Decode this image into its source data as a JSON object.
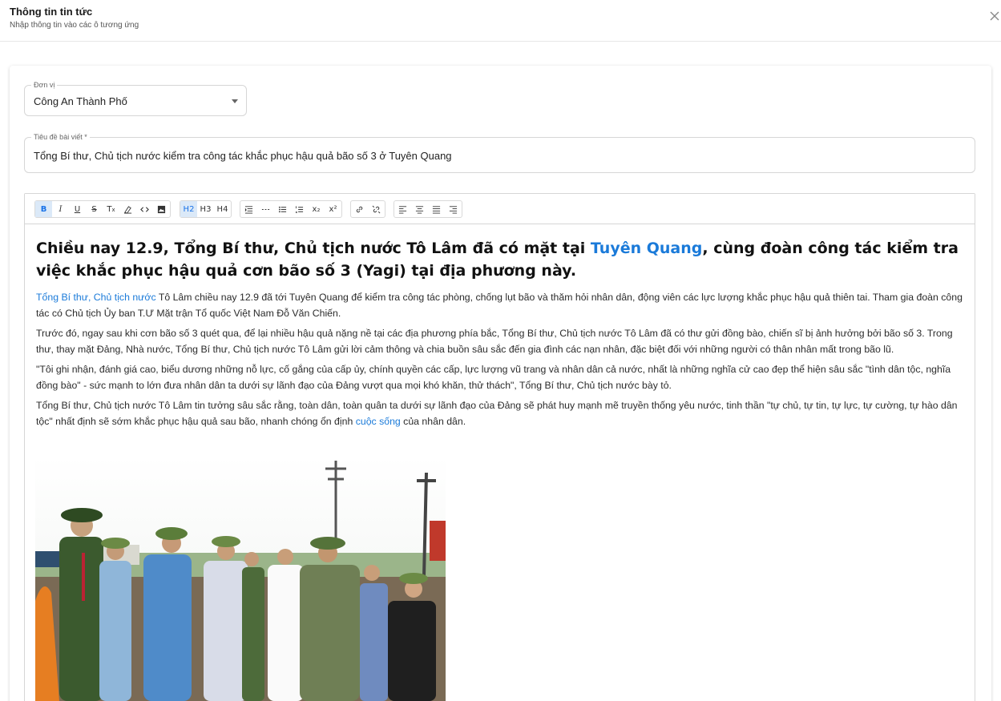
{
  "dialog": {
    "title": "Thông tin tin tức",
    "subtitle": "Nhập thông tin vào các ô tương ứng"
  },
  "form": {
    "unit": {
      "label": "Đơn vị",
      "value": "Công An Thành Phố"
    },
    "headline": {
      "label": "Tiêu đề bài viết *",
      "value": "Tổng Bí thư, Chủ tịch nước kiểm tra công tác khắc phục hậu quả bão số 3 ở Tuyên Quang"
    }
  },
  "toolbar": {
    "heading_buttons": [
      "H2",
      "H3",
      "H4"
    ],
    "subscript": "x₂",
    "superscript": "x²"
  },
  "article": {
    "heading_pre": "Chiều nay 12.9, Tổng Bí thư, Chủ tịch nước Tô Lâm đã có mặt tại ",
    "heading_link": "Tuyên Quang",
    "heading_post": ", cùng đoàn công tác kiểm tra việc khắc phục hậu quả cơn bão số 3 (Yagi) tại địa phương này.",
    "p1_link": "Tổng Bí thư, Chủ tịch nước",
    "p1_text": " Tô Lâm chiều nay 12.9 đã tới Tuyên Quang để kiểm tra công tác phòng, chống lụt bão và thăm hỏi nhân dân, động viên các lực lượng khắc phục hậu quả thiên tai. Tham gia đoàn công tác có Chủ tịch Ủy ban T.Ư Mặt trận Tổ quốc Việt Nam Đỗ Văn Chiến.",
    "p2": "Trước đó, ngay sau khi cơn bão số 3 quét qua, để lại nhiều hậu quả nặng nề tại các địa phương phía bắc, Tổng Bí thư, Chủ tịch nước Tô Lâm đã có thư gửi đồng bào, chiến sĩ bị ảnh hưởng bởi bão số 3. Trong thư, thay mặt Đảng, Nhà nước, Tổng Bí thư, Chủ tịch nước Tô Lâm gửi lời cảm thông và chia buồn sâu sắc đến gia đình các nạn nhân, đặc biệt đối với những người có thân nhân mất trong bão lũ.",
    "p3": "\"Tôi ghi nhận, đánh giá cao, biểu dương những nỗ lực, cố gắng của cấp ủy, chính quyền các cấp, lực lượng vũ trang và nhân dân cả nước, nhất là những nghĩa cử cao đẹp thể hiện sâu sắc \"tình dân tộc, nghĩa đồng bào\" - sức mạnh to lớn đưa nhân dân ta dưới sự lãnh đạo của Đảng vượt qua mọi khó khăn, thử thách\", Tổng Bí thư, Chủ tịch nước bày tỏ.",
    "p4_text": "Tổng Bí thư, Chủ tịch nước Tô Lâm tin tưởng sâu sắc rằng, toàn dân, toàn quân ta dưới sự lãnh đạo của Đảng sẽ phát huy mạnh mẽ truyền thống yêu nước, tinh thần \"tự chủ, tự tin, tự lực, tự cường, tự hào dân tộc\" nhất định sẽ sớm khắc phục hậu quả sau bão, nhanh chóng ổn định ",
    "p4_link": "cuộc sống",
    "p4_end": " của nhân dân."
  },
  "colors": {
    "link": "#1a7ad9",
    "active": "#dbe9f8"
  }
}
